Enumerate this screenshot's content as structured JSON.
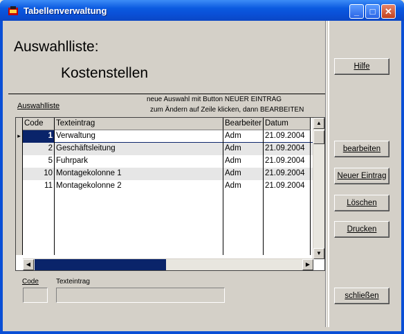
{
  "window": {
    "title": "Tabellenverwaltung",
    "minimize_glyph": "_",
    "maximize_glyph": "□",
    "close_glyph": "✕"
  },
  "header": {
    "heading": "Auswahlliste:",
    "subheading": "Kostenstellen"
  },
  "list": {
    "label": "Auswahlliste",
    "hint_line1": "neue Auswahl mit Button NEUER EINTRAG",
    "hint_line2": "zum Ändern auf Zeile klicken, dann BEARBEITEN",
    "columns": [
      "Code",
      "Texteintrag",
      "Bearbeiter",
      "Datum"
    ],
    "rows": [
      {
        "code": "1",
        "text": "Verwaltung",
        "bearbeiter": "Adm",
        "datum": "21.09.2004",
        "selected": true
      },
      {
        "code": "2",
        "text": "Geschäftsleitung",
        "bearbeiter": "Adm",
        "datum": "21.09.2004"
      },
      {
        "code": "5",
        "text": "Fuhrpark",
        "bearbeiter": "Adm",
        "datum": "21.09.2004"
      },
      {
        "code": "10",
        "text": "Montagekolonne 1",
        "bearbeiter": "Adm",
        "datum": "21.09.2004"
      },
      {
        "code": "11",
        "text": "Montagekolonne 2",
        "bearbeiter": "Adm",
        "datum": "21.09.2004"
      }
    ]
  },
  "edit": {
    "code_label": "Code",
    "text_label": "Texteintrag",
    "code_value": "",
    "text_value": ""
  },
  "buttons": {
    "hilfe": "Hilfe",
    "bearbeiten": "bearbeiten",
    "neuer_eintrag": "Neuer Eintrag",
    "loeschen": "Löschen",
    "drucken": "Drucken",
    "schliessen": "schließen"
  },
  "colors": {
    "title_bar": "#0a4fd6",
    "selection": "#0a246a",
    "row_alt": "#e6e6e6"
  }
}
